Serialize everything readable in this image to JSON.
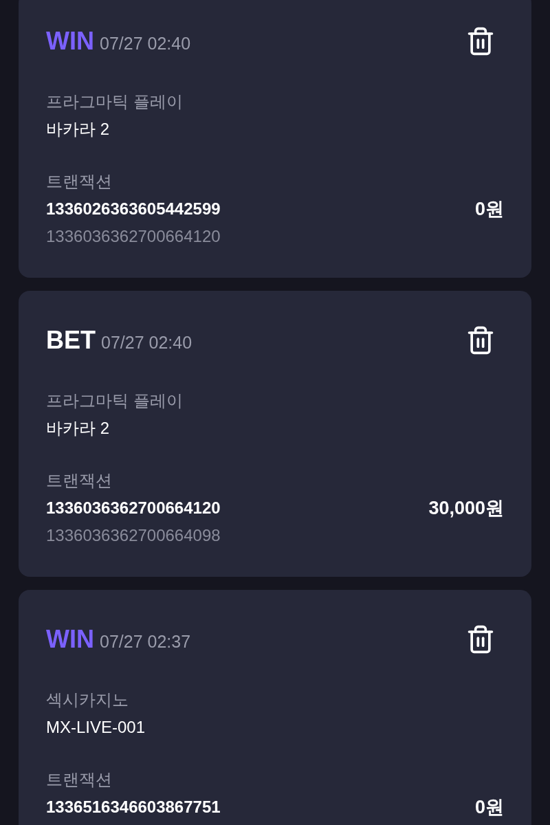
{
  "transactions": [
    {
      "kind": "win",
      "type": "WIN",
      "time": "07/27 02:40",
      "provider": "프라그마틱 플레이",
      "game": "바카라 2",
      "tx_label": "트랜잭션",
      "tx_id": "1336026363605442599",
      "ref_id": "1336036362700664120",
      "amount": "0원"
    },
    {
      "kind": "bet",
      "type": "BET",
      "time": "07/27 02:40",
      "provider": "프라그마틱 플레이",
      "game": "바카라 2",
      "tx_label": "트랜잭션",
      "tx_id": "1336036362700664120",
      "ref_id": "1336036362700664098",
      "amount": "30,000원"
    },
    {
      "kind": "win",
      "type": "WIN",
      "time": "07/27 02:37",
      "provider": "섹시카지노",
      "game": "MX-LIVE-001",
      "tx_label": "트랜잭션",
      "tx_id": "1336516346603867751",
      "amount": "0원"
    }
  ]
}
